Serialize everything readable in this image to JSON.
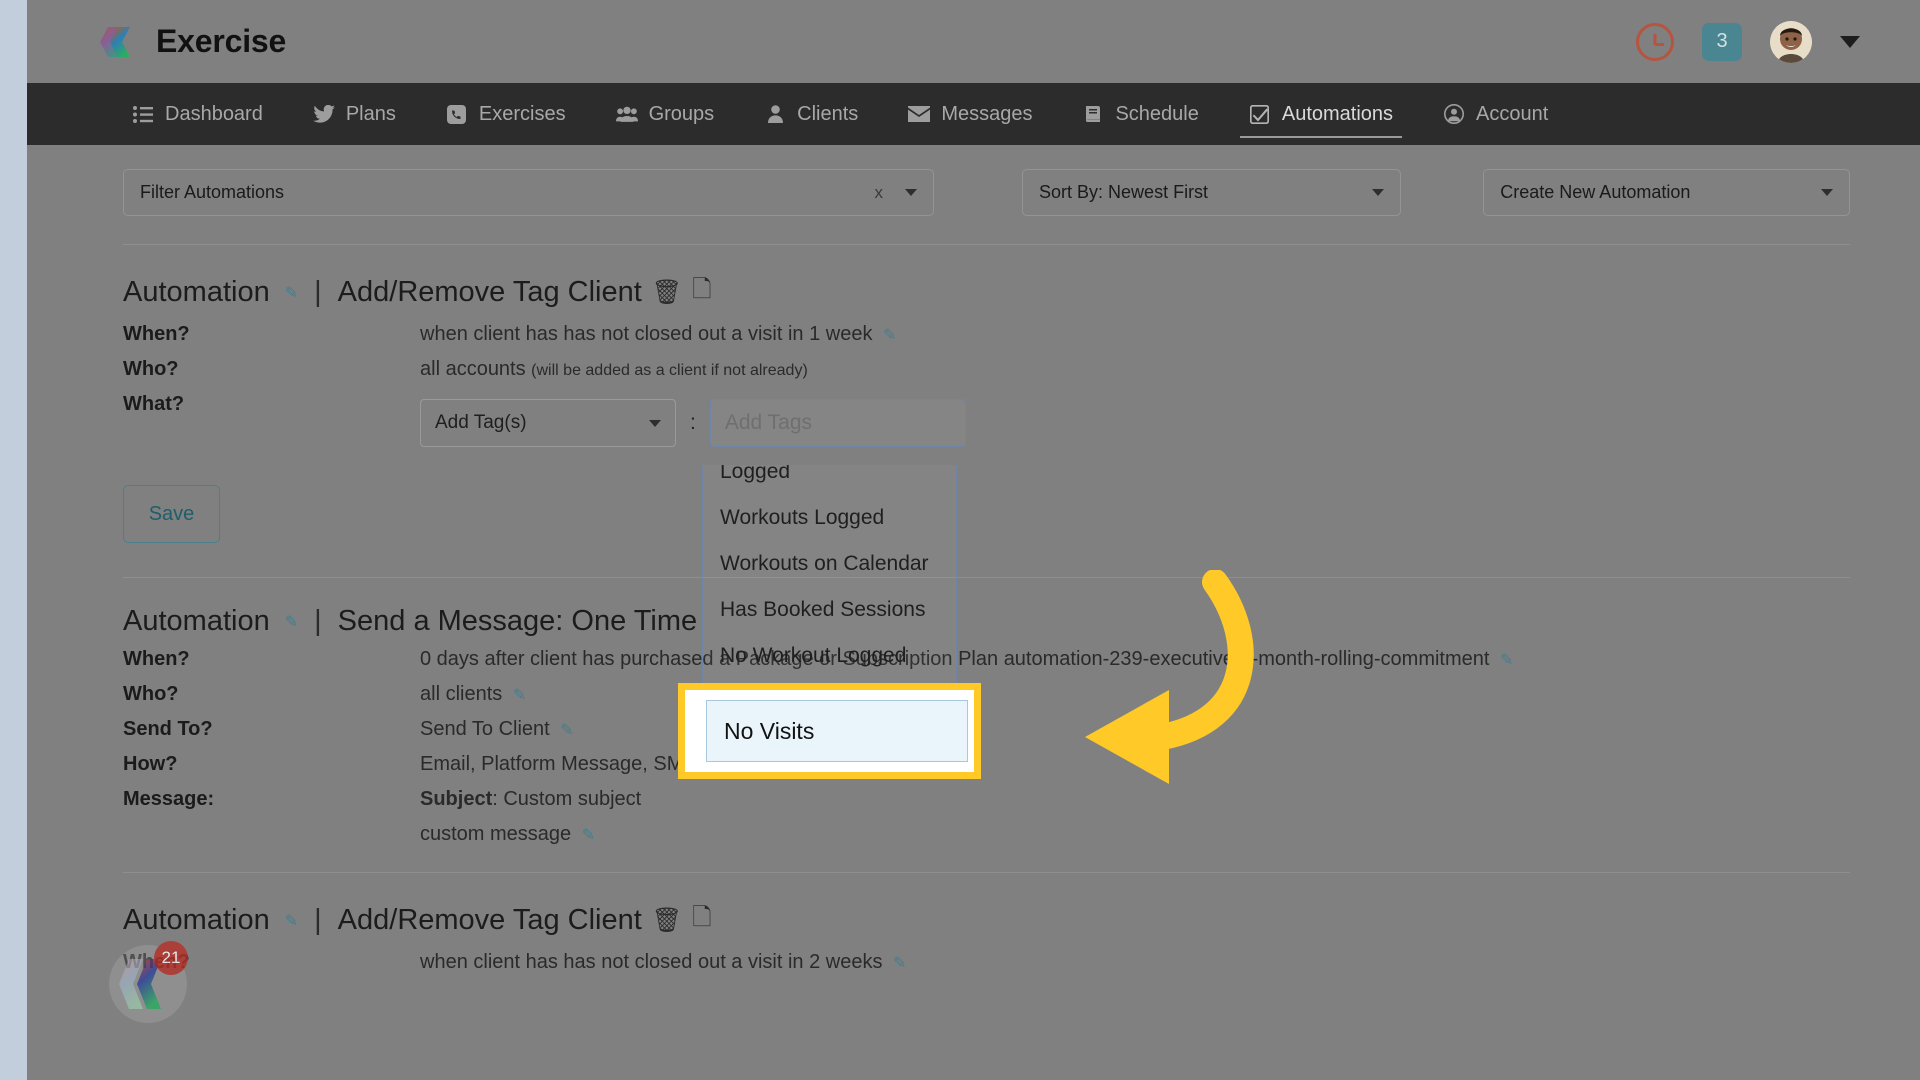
{
  "header": {
    "brand": "Exercise",
    "logo_icon": "exercise-chevrons-logo",
    "clock_icon": "clock-icon",
    "notification_count": "3",
    "avatar_icon": "user-avatar",
    "chevron_icon": "chevron-down-icon"
  },
  "nav": {
    "items": [
      {
        "label": "Dashboard",
        "icon": "list-icon",
        "active": false
      },
      {
        "label": "Plans",
        "icon": "bird-icon",
        "active": false
      },
      {
        "label": "Exercises",
        "icon": "phone-icon",
        "active": false
      },
      {
        "label": "Groups",
        "icon": "people-icon",
        "active": false
      },
      {
        "label": "Clients",
        "icon": "person-icon",
        "active": false
      },
      {
        "label": "Messages",
        "icon": "envelope-icon",
        "active": false
      },
      {
        "label": "Schedule",
        "icon": "book-icon",
        "active": false
      },
      {
        "label": "Automations",
        "icon": "check-box-icon",
        "active": true
      },
      {
        "label": "Account",
        "icon": "account-icon",
        "active": false
      }
    ]
  },
  "toolbar": {
    "filter_placeholder": "Filter Automations",
    "filter_clear": "x",
    "sort_by": "Sort By: Newest First",
    "create_new": "Create New Automation"
  },
  "automations": [
    {
      "prefix": "Automation",
      "separator": "|",
      "title": "Add/Remove Tag Client",
      "edit_icon": "pencil-icon",
      "delete_icon": "trash-icon",
      "copy_icon": "copy-icon",
      "rows": [
        {
          "key": "When?",
          "value": "when client has has not closed out a visit in 1 week",
          "editable": true
        },
        {
          "key": "Who?",
          "value": "all accounts ",
          "note": "(will be added as a client if not already)",
          "editable": false
        },
        {
          "key": "What?",
          "value": "",
          "editable": false
        }
      ],
      "tag_action": "Add Tag(s)",
      "tag_separator": ":",
      "tag_input_placeholder": "Add Tags",
      "save_label": "Save"
    },
    {
      "prefix": "Automation",
      "separator": "|",
      "title": "Send a Message: One Time",
      "edit_icon": "pencil-icon",
      "rows": [
        {
          "key": "When?",
          "value": "0 days after client has purchased a Package or Subscription Plan",
          "value_tail": "automation-239-executive-3-month-rolling-commitment",
          "editable": true
        },
        {
          "key": "Who?",
          "value": "all clients",
          "editable": true
        },
        {
          "key": "Send To?",
          "value": "Send To Client",
          "editable": true
        },
        {
          "key": "How?",
          "value": "Email, Platform Message, SMS Text Message",
          "editable": true
        },
        {
          "key": "Message:",
          "value_bold": "Subject",
          "value": ": Custom subject",
          "editable": false
        },
        {
          "key": "",
          "value": "custom message",
          "editable": true
        }
      ]
    },
    {
      "prefix": "Automation",
      "separator": "|",
      "title": "Add/Remove Tag Client",
      "edit_icon": "pencil-icon",
      "delete_icon": "trash-icon",
      "copy_icon": "copy-icon",
      "rows": [
        {
          "key": "When?",
          "value": "when client has has not closed out a visit in 2 weeks",
          "editable": true
        }
      ]
    }
  ],
  "tag_dropdown": {
    "options": [
      "Logged",
      "Workouts Logged",
      "Workouts on Calendar",
      "Has Booked Sessions",
      "No Workout Logged"
    ],
    "highlighted_option": "No Visits"
  },
  "annotation": {
    "arrow_color": "#ffc928",
    "highlight_border_color": "#ffc928"
  },
  "chat_widget": {
    "badge_count": "21",
    "icon": "chat-logo-icon"
  },
  "colors": {
    "nav_bg": "#2c2c2c",
    "accent_teal": "#4a8592",
    "accent_red": "#b5543f",
    "highlight_yellow": "#ffc928",
    "dim_overlay": "#808080"
  }
}
